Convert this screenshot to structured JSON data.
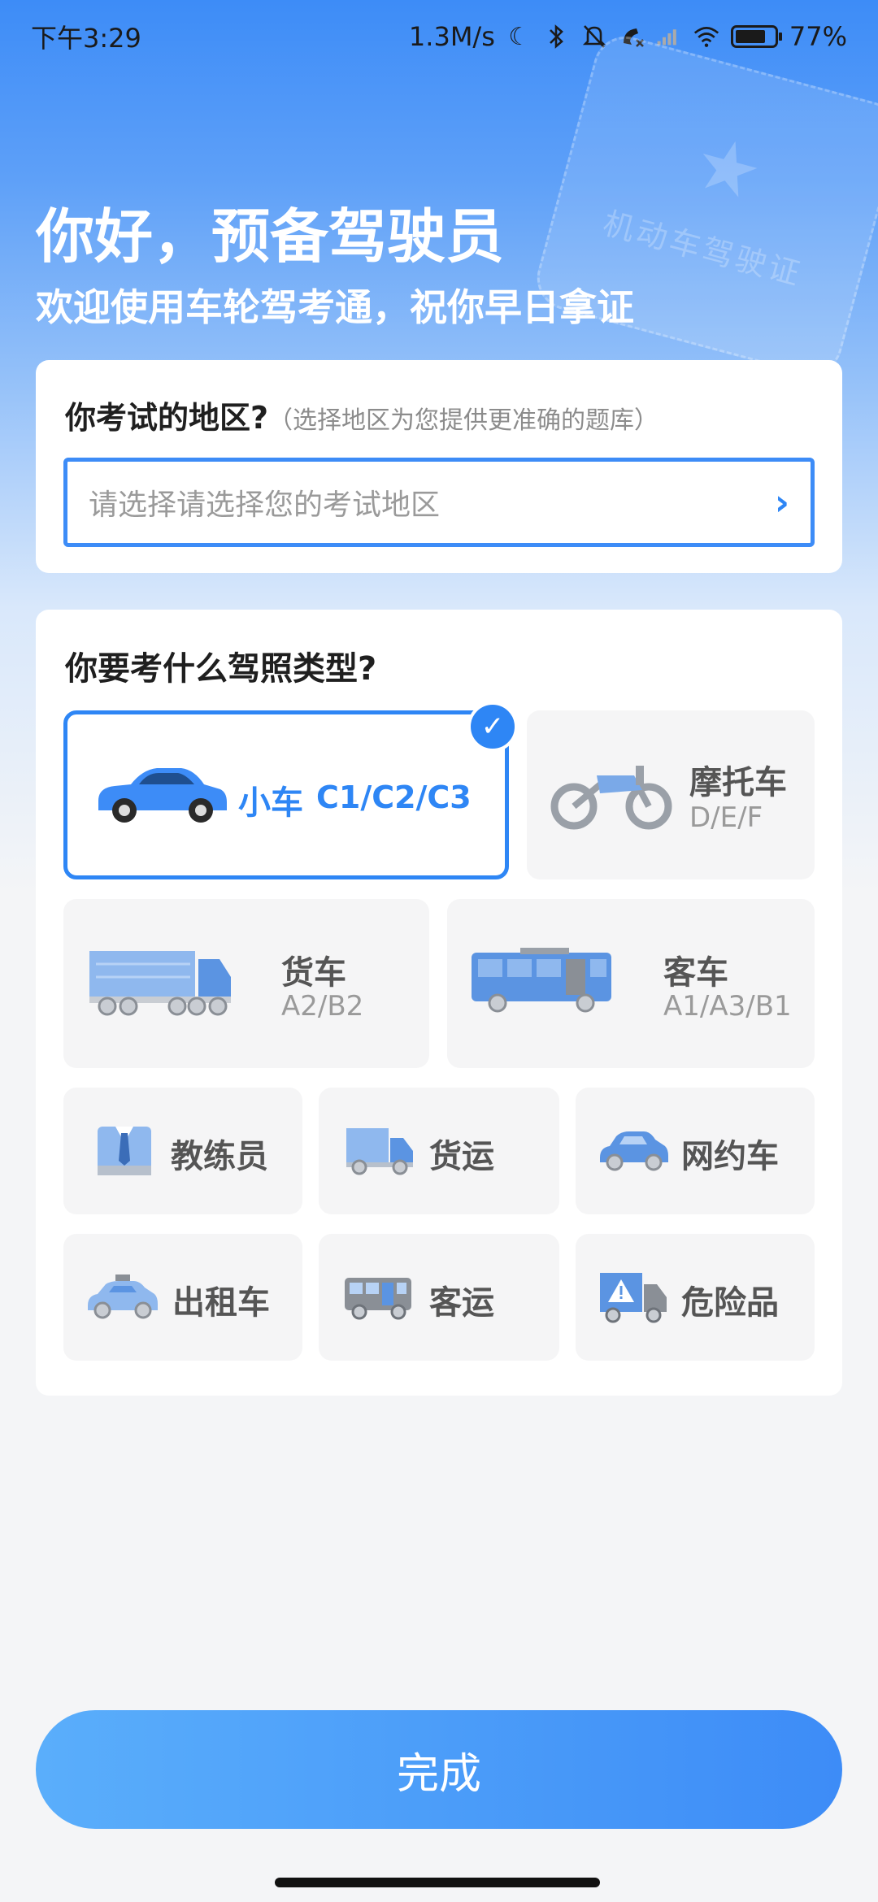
{
  "status_bar": {
    "time": "下午3:29",
    "net_speed": "1.3M/s",
    "battery_pct": "77%"
  },
  "hero": {
    "greeting": "你好，预备驾驶员",
    "welcome": "欢迎使用车轮驾考通，祝你早日拿证",
    "license_text": "机动车驾驶证"
  },
  "region": {
    "title": "你考试的地区?",
    "hint": "（选择地区为您提供更准确的题库）",
    "placeholder": "请选择请选择您的考试地区"
  },
  "license_types": {
    "title": "你要考什么驾照类型?",
    "car": {
      "label": "小车",
      "sub": "C1/C2/C3",
      "selected": true
    },
    "motorcycle": {
      "label": "摩托车",
      "sub": "D/E/F"
    },
    "truck": {
      "label": "货车",
      "sub": "A2/B2"
    },
    "bus": {
      "label": "客车",
      "sub": "A1/A3/B1"
    },
    "coach": {
      "label": "教练员"
    },
    "freight": {
      "label": "货运"
    },
    "ride_hailing": {
      "label": "网约车"
    },
    "taxi": {
      "label": "出租车"
    },
    "passenger_transport": {
      "label": "客运"
    },
    "hazmat": {
      "label": "危险品"
    }
  },
  "done_button": "完成",
  "colors": {
    "accent": "#2e86f5",
    "hero_top": "#3d8cf7"
  }
}
